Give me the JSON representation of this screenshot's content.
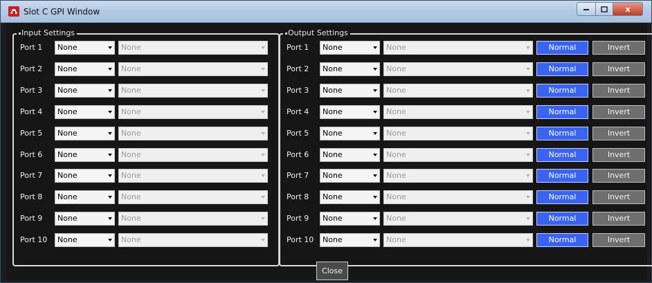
{
  "window": {
    "title": "Slot C GPI Window",
    "close_glyph": "x"
  },
  "input_settings": {
    "legend": "Input Settings",
    "ports": [
      {
        "label": "Port 1",
        "source": "None",
        "target": "None"
      },
      {
        "label": "Port 2",
        "source": "None",
        "target": "None"
      },
      {
        "label": "Port 3",
        "source": "None",
        "target": "None"
      },
      {
        "label": "Port 4",
        "source": "None",
        "target": "None"
      },
      {
        "label": "Port 5",
        "source": "None",
        "target": "None"
      },
      {
        "label": "Port 6",
        "source": "None",
        "target": "None"
      },
      {
        "label": "Port 7",
        "source": "None",
        "target": "None"
      },
      {
        "label": "Port 8",
        "source": "None",
        "target": "None"
      },
      {
        "label": "Port 9",
        "source": "None",
        "target": "None"
      },
      {
        "label": "Port 10",
        "source": "None",
        "target": "None"
      }
    ]
  },
  "output_settings": {
    "legend": "Output Settings",
    "ports": [
      {
        "label": "Port 1",
        "source": "None",
        "target": "None",
        "normal": "Normal",
        "invert": "Invert"
      },
      {
        "label": "Port 2",
        "source": "None",
        "target": "None",
        "normal": "Normal",
        "invert": "Invert"
      },
      {
        "label": "Port 3",
        "source": "None",
        "target": "None",
        "normal": "Normal",
        "invert": "Invert"
      },
      {
        "label": "Port 4",
        "source": "None",
        "target": "None",
        "normal": "Normal",
        "invert": "Invert"
      },
      {
        "label": "Port 5",
        "source": "None",
        "target": "None",
        "normal": "Normal",
        "invert": "Invert"
      },
      {
        "label": "Port 6",
        "source": "None",
        "target": "None",
        "normal": "Normal",
        "invert": "Invert"
      },
      {
        "label": "Port 7",
        "source": "None",
        "target": "None",
        "normal": "Normal",
        "invert": "Invert"
      },
      {
        "label": "Port 8",
        "source": "None",
        "target": "None",
        "normal": "Normal",
        "invert": "Invert"
      },
      {
        "label": "Port 9",
        "source": "None",
        "target": "None",
        "normal": "Normal",
        "invert": "Invert"
      },
      {
        "label": "Port 10",
        "source": "None",
        "target": "None",
        "normal": "Normal",
        "invert": "Invert"
      }
    ]
  },
  "footer": {
    "close_label": "Close"
  },
  "colors": {
    "normal_button": "#3b63f2",
    "invert_button": "#6e6e6e",
    "background": "#161616",
    "border": "#d9d9d9"
  },
  "icons": {
    "app": "app-icon",
    "minimize": "minimize-icon",
    "maximize": "maximize-icon",
    "close": "close-icon"
  }
}
